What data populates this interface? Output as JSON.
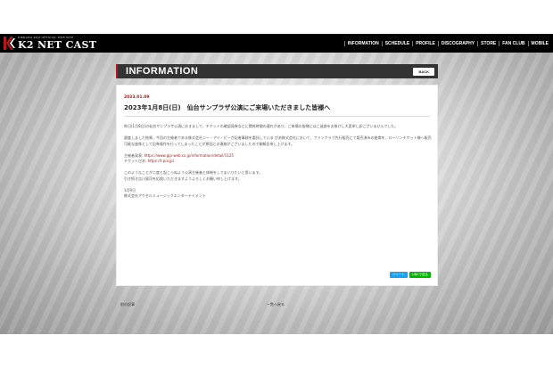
{
  "header": {
    "logo_small": "KIKKAWA KOJI OFFICIAL WEB SITE",
    "logo_big": "K2 NET CAST",
    "nav": [
      "INFORMATION",
      "SCHEDULE",
      "PROFILE",
      "DISCOGRAPHY",
      "STORE",
      "FAN CLUB",
      "MOBILE"
    ]
  },
  "section": {
    "title": "INFORMATION",
    "back_label": "BACK"
  },
  "article": {
    "date": "2023.01.09",
    "title": "2023年1月8日(日)　仙台サンプラザ公演にご来場いただきました皆様へ",
    "p1": "昨日(1月8日)の仙台サンプラザ公演におきまして、チケットの確認発券などに関係時間の遅れがあり、ご来場の皆様にはご迷惑をお掛けし大変申し訳ございませんでした。",
    "p2": "調査しました結果、今回の主催者である株式会社ジー・アイ・ピーが記者事務を委託している ぴあ株式会社において、ファンクラブ先行販売にて既売済みの座席を、ローソンチケット様へ販売可能な座席として記券操作を行ってしまったことが原因との連絡がございましたので御報告申し上げます。",
    "sponsor_label": "主催者発表: ",
    "sponsor_link": "https://www.gip-web.co.jp/information/detail/1125",
    "pia_label": "チケットぴあ: ",
    "pia_link": "https://t.pia.jp/",
    "p4_line1": "このようなことが二度と起こらぬよう公演主催者と体制をしてまいりたいと思います。",
    "p4_line2": "引き続き吉川晃司を応援いただきますようよろしくお願い申し上げます。",
    "sign_date": "1月9日",
    "sign_company": "株式会社アクセルミュージックエンターテイメント"
  },
  "share": {
    "tweet": "ツイート",
    "line": "LINEで送る"
  },
  "pager": {
    "prev": "前の記事",
    "list": "一覧へ戻る"
  },
  "colors": {
    "accent": "#b21a1a",
    "header_bg": "#000000",
    "bar_bg": "#333333"
  }
}
